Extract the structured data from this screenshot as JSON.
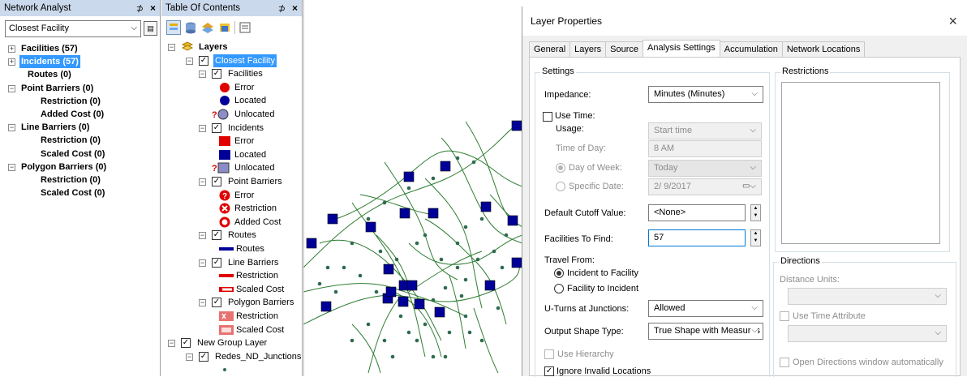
{
  "network_analyst": {
    "title": "Network Analyst",
    "pin": "⊅",
    "close": "×",
    "dropdown": "Closest Facility",
    "items": [
      {
        "label": "Facilities (57)",
        "level": 0,
        "expander": "+",
        "highlight": false
      },
      {
        "label": "Incidents (57)",
        "level": 0,
        "expander": "+",
        "highlight": true
      },
      {
        "label": "Routes (0)",
        "level": 1,
        "expander": "",
        "highlight": false
      },
      {
        "label": "Point Barriers (0)",
        "level": 0,
        "expander": "−",
        "highlight": false
      },
      {
        "label": "Restriction (0)",
        "level": 2,
        "expander": "",
        "highlight": false
      },
      {
        "label": "Added Cost (0)",
        "level": 2,
        "expander": "",
        "highlight": false
      },
      {
        "label": "Line Barriers (0)",
        "level": 0,
        "expander": "−",
        "highlight": false
      },
      {
        "label": "Restriction (0)",
        "level": 2,
        "expander": "",
        "highlight": false
      },
      {
        "label": "Scaled Cost (0)",
        "level": 2,
        "expander": "",
        "highlight": false
      },
      {
        "label": "Polygon Barriers (0)",
        "level": 0,
        "expander": "−",
        "highlight": false
      },
      {
        "label": "Restriction (0)",
        "level": 2,
        "expander": "",
        "highlight": false
      },
      {
        "label": "Scaled Cost (0)",
        "level": 2,
        "expander": "",
        "highlight": false
      }
    ]
  },
  "toc": {
    "title": "Table Of Contents",
    "pin": "⊅",
    "close": "×",
    "rows": [
      {
        "label": "Layers",
        "level": 0,
        "expander": "−",
        "checkbox": false,
        "symbol": "layers-icon",
        "bold": true
      },
      {
        "label": "Closest Facility",
        "level": 1,
        "expander": "−",
        "checkbox": true,
        "symbol": "",
        "highlight": true
      },
      {
        "label": "Facilities",
        "level": 2,
        "expander": "−",
        "checkbox": true,
        "symbol": ""
      },
      {
        "label": "Error",
        "level": 3,
        "symbol": "red-circle"
      },
      {
        "label": "Located",
        "level": 3,
        "symbol": "blue-circle"
      },
      {
        "label": "Unlocated",
        "level": 3,
        "symbol": "unlocated-circle"
      },
      {
        "label": "Incidents",
        "level": 2,
        "expander": "−",
        "checkbox": true,
        "symbol": ""
      },
      {
        "label": "Error",
        "level": 3,
        "symbol": "red-square"
      },
      {
        "label": "Located",
        "level": 3,
        "symbol": "blue-square"
      },
      {
        "label": "Unlocated",
        "level": 3,
        "symbol": "unlocated-square"
      },
      {
        "label": "Point Barriers",
        "level": 2,
        "expander": "−",
        "checkbox": true,
        "symbol": ""
      },
      {
        "label": "Error",
        "level": 3,
        "symbol": "error-barrier"
      },
      {
        "label": "Restriction",
        "level": 3,
        "symbol": "restriction-barrier"
      },
      {
        "label": "Added Cost",
        "level": 3,
        "symbol": "addedcost-barrier"
      },
      {
        "label": "Routes",
        "level": 2,
        "expander": "−",
        "checkbox": true,
        "symbol": ""
      },
      {
        "label": "Routes",
        "level": 3,
        "symbol": "route-line"
      },
      {
        "label": "Line Barriers",
        "level": 2,
        "expander": "−",
        "checkbox": true,
        "symbol": ""
      },
      {
        "label": "Restriction",
        "level": 3,
        "symbol": "restriction-line"
      },
      {
        "label": "Scaled Cost",
        "level": 3,
        "symbol": "scaledcost-line"
      },
      {
        "label": "Polygon Barriers",
        "level": 2,
        "expander": "−",
        "checkbox": true,
        "symbol": ""
      },
      {
        "label": "Restriction",
        "level": 3,
        "symbol": "restriction-poly"
      },
      {
        "label": "Scaled Cost",
        "level": 3,
        "symbol": "scaledcost-poly"
      },
      {
        "label": "New Group Layer",
        "level": 0,
        "expander": "−",
        "checkbox": true,
        "symbol": ""
      },
      {
        "label": "Redes_ND_Junctions",
        "level": 1,
        "expander": "−",
        "checkbox": true,
        "symbol": ""
      },
      {
        "label": "",
        "level": 2,
        "symbol": "junction-dot"
      }
    ]
  },
  "dialog": {
    "title": "Layer Properties",
    "close": "×",
    "tabs": [
      "General",
      "Layers",
      "Source",
      "Analysis Settings",
      "Accumulation",
      "Network Locations"
    ],
    "active_tab": 3,
    "settings": {
      "group": "Settings",
      "impedance_label": "Impedance:",
      "impedance_value": "Minutes (Minutes)",
      "use_time_label": "Use Time:",
      "usage_label": "Usage:",
      "usage_value": "Start time",
      "time_of_day_label": "Time of Day:",
      "time_of_day_value": "8 AM",
      "day_of_week_label": "Day of Week:",
      "day_of_week_value": "Today",
      "specific_date_label": "Specific Date:",
      "specific_date_value": "2/ 9/2017",
      "cutoff_label": "Default Cutoff Value:",
      "cutoff_value": "<None>",
      "facilities_label": "Facilities To Find:",
      "facilities_value": "57",
      "travel_from_label": "Travel From:",
      "travel_opt1": "Incident to Facility",
      "travel_opt2": "Facility to Incident",
      "uturns_label": "U-Turns at Junctions:",
      "uturns_value": "Allowed",
      "shape_label": "Output Shape Type:",
      "shape_value": "True Shape with Measures",
      "hierarchy_label": "Use Hierarchy",
      "ignore_label": "Ignore Invalid Locations"
    },
    "restrictions": {
      "group": "Restrictions"
    },
    "directions": {
      "group": "Directions",
      "distance_units_label": "Distance Units:",
      "time_attr_label": "Use Time Attribute",
      "open_dir_label": "Open Directions window automatically"
    }
  },
  "colors": {
    "panel_title": "#cbd9ec",
    "selection": "#3399ff",
    "route": "#2e7d32",
    "facility": "#000099",
    "junction": "#2f6b4f"
  }
}
